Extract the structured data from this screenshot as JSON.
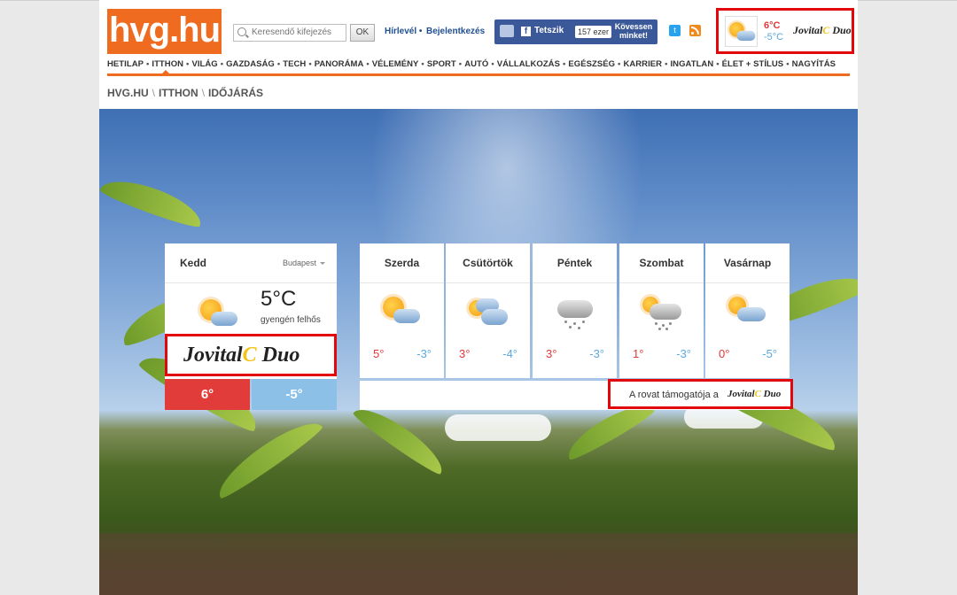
{
  "header": {
    "logo": "hvg.hu",
    "search_placeholder": "Keresendő kifejezés",
    "search_button": "OK",
    "newsletter": "Hírlevél",
    "login": "Bejelentkezés",
    "facebook": {
      "like": "Tetszik",
      "count": "157 ezer",
      "follow": "Kövessen minket!"
    },
    "weather": {
      "hi": "6°C",
      "lo": "-5°C",
      "sponsor_a": "Jovital",
      "sponsor_c": "C",
      "sponsor_b": "Duo"
    }
  },
  "nav": [
    "HETILAP",
    "ITTHON",
    "VILÁG",
    "GAZDASÁG",
    "TECH",
    "PANORÁMA",
    "VÉLEMÉNY",
    "SPORT",
    "AUTÓ",
    "VÁLLALKOZÁS",
    "EGÉSZSÉG",
    "KARRIER",
    "INGATLAN",
    "ÉLET + STÍLUS",
    "NAGYÍTÁS"
  ],
  "nav_active": "ITTHON",
  "breadcrumb": [
    "HVG.HU",
    "ITTHON",
    "IDŐJÁRÁS"
  ],
  "today": {
    "day": "Kedd",
    "city": "Budapest",
    "temp": "5°C",
    "desc": "gyengén felhős",
    "icon": "sun-cloud-icon",
    "hi": "6°",
    "lo": "-5°",
    "sponsor_a": "Jovital",
    "sponsor_c": "C",
    "sponsor_b": "Duo"
  },
  "forecast": [
    {
      "day": "Szerda",
      "icon": "sun-cloud-icon",
      "hi": "5°",
      "lo": "-3°"
    },
    {
      "day": "Csütörtök",
      "icon": "sun-clouds-icon",
      "hi": "3°",
      "lo": "-4°"
    },
    {
      "day": "Péntek",
      "icon": "snow-cloud-icon",
      "hi": "3°",
      "lo": "-3°"
    },
    {
      "day": "Szombat",
      "icon": "sun-snow-cloud-icon",
      "hi": "1°",
      "lo": "-3°"
    },
    {
      "day": "Vasárnap",
      "icon": "sun-cloud-icon",
      "hi": "0°",
      "lo": "-5°"
    }
  ],
  "sponsor_note": {
    "label": "A rovat támogatója a",
    "brand_a": "Jovital",
    "brand_c": "C",
    "brand_b": "Duo"
  },
  "colors": {
    "brand_orange": "#ee6b1f",
    "highlight_red": "#e1070a",
    "hi_red": "#e13c3a",
    "lo_blue": "#8cc0e6"
  }
}
